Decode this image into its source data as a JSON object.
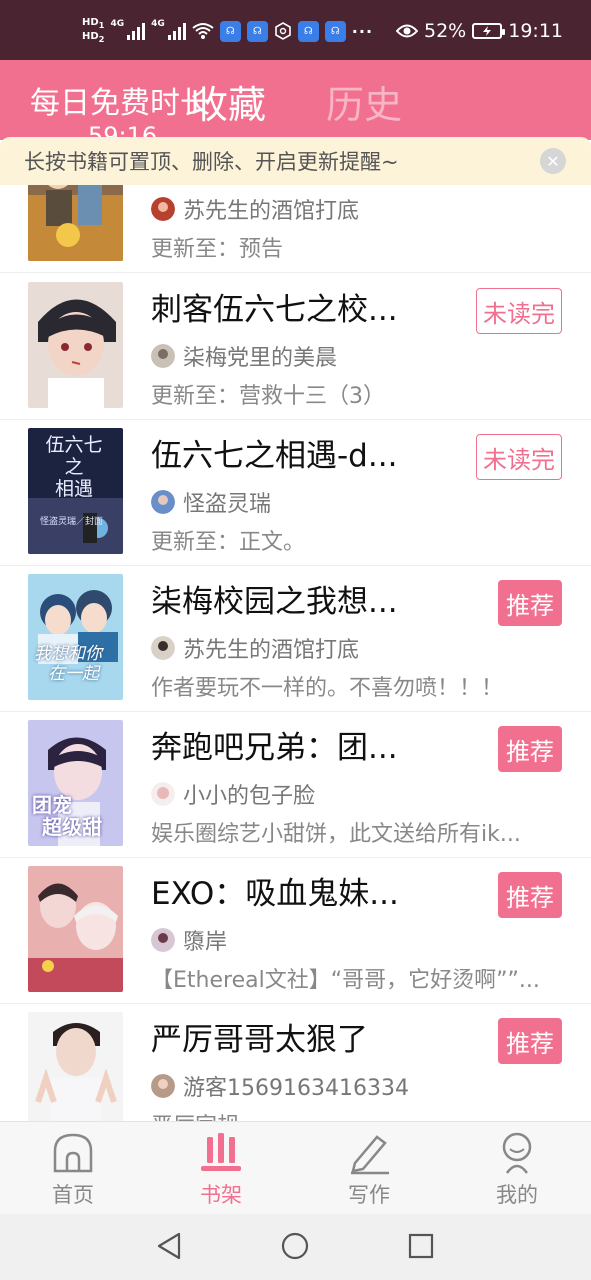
{
  "status_bar": {
    "hd1": "HD",
    "hd1_sub": "1",
    "hd2": "HD",
    "hd2_sub": "2",
    "net1": "4G",
    "net2": "4G",
    "more": "···",
    "battery_percent": "52%",
    "time": "19:11"
  },
  "header": {
    "promo_text": "每日免费时长",
    "promo_time": "59:16",
    "tab_favorites": "收藏",
    "tab_history": "历史"
  },
  "tip": {
    "text": "长按书籍可置顶、删除、开启更新提醒~",
    "close": "✕"
  },
  "books": [
    {
      "title": "",
      "author": "苏先生的酒馆打底",
      "desc": "更新至：预告",
      "badge": "",
      "badge_type": "outline"
    },
    {
      "title": "刺客伍六七之校...",
      "author": "柒梅党里的美晨",
      "desc": "更新至：营救十三（3）",
      "badge": "未读完",
      "badge_type": "outline"
    },
    {
      "title": "伍六七之相遇-d...",
      "author": "怪盗灵瑞",
      "desc": "更新至：正文。",
      "badge": "未读完",
      "badge_type": "outline",
      "cover_text_1": "伍六七",
      "cover_text_2": "之",
      "cover_text_3": "相遇",
      "cover_text_4": "怪盗灵瑞／封面"
    },
    {
      "title": "柒梅校园之我想...",
      "author": "苏先生的酒馆打底",
      "desc": "作者要玩不一样的。不喜勿喷！！！",
      "badge": "推荐",
      "badge_type": "fill",
      "cover_text_1": "我想和你",
      "cover_text_2": "在一起"
    },
    {
      "title": "奔跑吧兄弟：团...",
      "author": "小小的包子脸",
      "desc": "娱乐圈综艺小甜饼，此文送给所有ik...",
      "badge": "推荐",
      "badge_type": "fill",
      "cover_text_1": "团宠",
      "cover_text_2": "超级甜"
    },
    {
      "title": "EXO：吸血鬼妹...",
      "author": "隳岸",
      "desc": "【Ethereal文社】“哥哥，它好烫啊””...",
      "badge": "推荐",
      "badge_type": "fill"
    },
    {
      "title": "严厉哥哥太狠了",
      "author": "游客1569163416334",
      "desc": "严厉家规",
      "badge": "推荐",
      "badge_type": "fill"
    }
  ],
  "bottom_nav": [
    {
      "label": "首页",
      "icon": "home-icon",
      "active": false
    },
    {
      "label": "书架",
      "icon": "bookshelf-icon",
      "active": true
    },
    {
      "label": "写作",
      "icon": "pen-icon",
      "active": false
    },
    {
      "label": "我的",
      "icon": "profile-icon",
      "active": false
    }
  ],
  "colors": {
    "accent": "#f2708f",
    "status_bar": "#4a2430",
    "tip_bg": "#fcf3d9"
  }
}
